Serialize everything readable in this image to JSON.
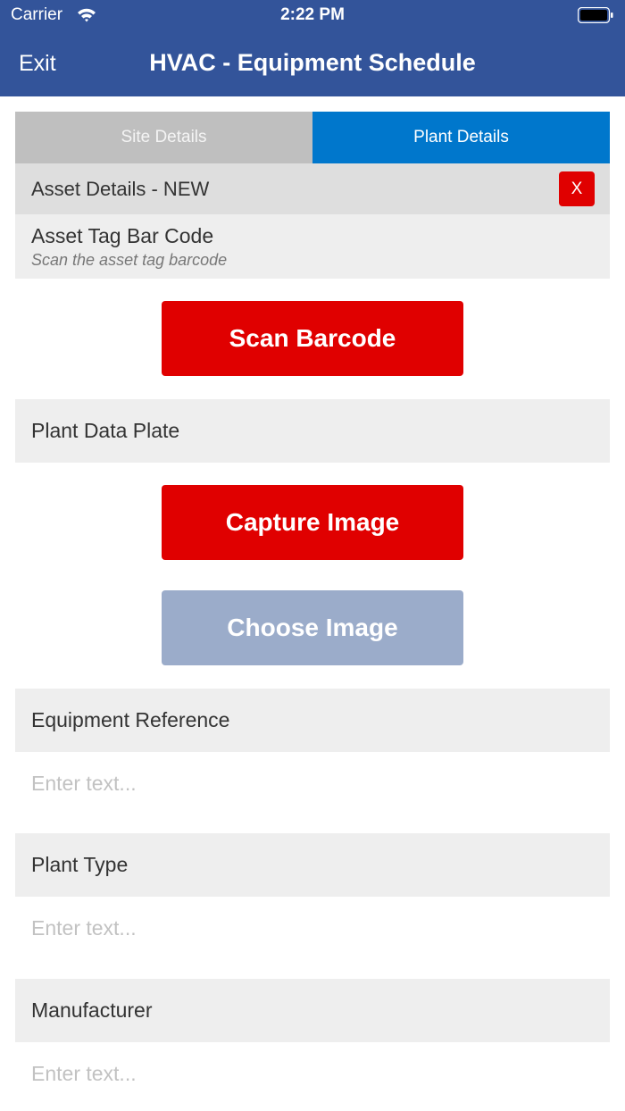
{
  "status_bar": {
    "carrier": "Carrier",
    "time": "2:22 PM"
  },
  "header": {
    "exit_label": "Exit",
    "title": "HVAC - Equipment Schedule"
  },
  "tabs": [
    {
      "label": "Site Details",
      "active": false
    },
    {
      "label": "Plant Details",
      "active": true
    }
  ],
  "asset_header": {
    "label": "Asset Details - NEW",
    "close_label": "X"
  },
  "asset_tag": {
    "label": "Asset Tag Bar Code",
    "hint": "Scan the asset tag barcode"
  },
  "scan_button": {
    "label": "Scan Barcode"
  },
  "plant_data_plate": {
    "label": "Plant Data Plate"
  },
  "capture_button": {
    "label": "Capture Image"
  },
  "choose_button": {
    "label": "Choose Image",
    "state": "disabled"
  },
  "fields": [
    {
      "label": "Equipment Reference",
      "placeholder": "Enter text...",
      "value": ""
    },
    {
      "label": "Plant Type",
      "placeholder": "Enter text...",
      "value": ""
    },
    {
      "label": "Manufacturer",
      "placeholder": "Enter text...",
      "value": ""
    }
  ],
  "colors": {
    "header": "#33549a",
    "active_tab": "#0077cc",
    "primary_button": "#e00000",
    "disabled_button": "#9bacca"
  },
  "icons": {
    "wifi": "wifi-icon",
    "battery": "battery-icon"
  }
}
